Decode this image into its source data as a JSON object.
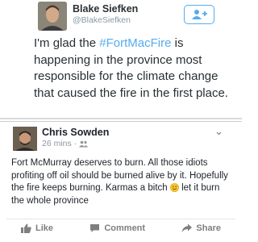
{
  "tweet": {
    "author_name": "Blake Siefken",
    "author_handle": "@BlakeSiefken",
    "text_before": "I'm glad the ",
    "hashtag": "#FortMacFire",
    "text_after": " is happening in the province most responsible for the climate change that caused the fire in the first place.",
    "follow_icon": "follow-user-icon",
    "colors": {
      "accent": "#55acee",
      "text": "#292f33",
      "muted": "#8899a6"
    }
  },
  "facebook_post": {
    "author_name": "Chris Sowden",
    "timestamp": "26 mins",
    "separator": "·",
    "audience_icon": "friends-icon",
    "text_before_emoji": "Fort McMurray deserves to burn. All those idiots profiting off oil should be burned alive by it. Hopefully the fire keeps burning. Karmas a bitch ",
    "emoji": "smiley-face-icon",
    "text_after_emoji": " let it burn the whole province",
    "actions": {
      "like_label": "Like",
      "comment_label": "Comment",
      "share_label": "Share"
    },
    "colors": {
      "text": "#1d2129",
      "muted": "#90949c",
      "action": "#7f7f7f"
    }
  }
}
